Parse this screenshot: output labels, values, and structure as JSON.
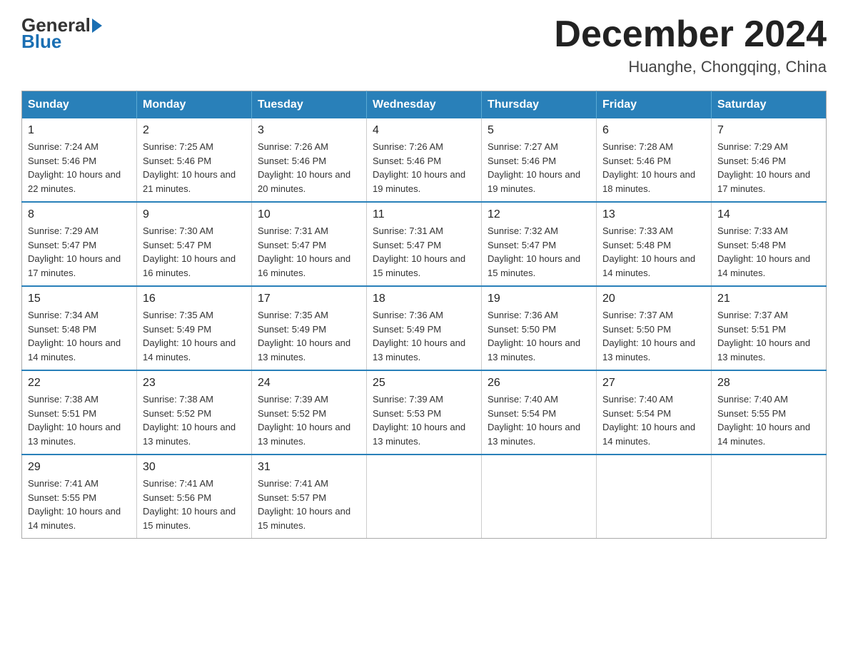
{
  "logo": {
    "general": "General",
    "blue": "Blue"
  },
  "title": "December 2024",
  "location": "Huanghe, Chongqing, China",
  "days_of_week": [
    "Sunday",
    "Monday",
    "Tuesday",
    "Wednesday",
    "Thursday",
    "Friday",
    "Saturday"
  ],
  "weeks": [
    [
      {
        "day": "1",
        "sunrise": "7:24 AM",
        "sunset": "5:46 PM",
        "daylight": "10 hours and 22 minutes."
      },
      {
        "day": "2",
        "sunrise": "7:25 AM",
        "sunset": "5:46 PM",
        "daylight": "10 hours and 21 minutes."
      },
      {
        "day": "3",
        "sunrise": "7:26 AM",
        "sunset": "5:46 PM",
        "daylight": "10 hours and 20 minutes."
      },
      {
        "day": "4",
        "sunrise": "7:26 AM",
        "sunset": "5:46 PM",
        "daylight": "10 hours and 19 minutes."
      },
      {
        "day": "5",
        "sunrise": "7:27 AM",
        "sunset": "5:46 PM",
        "daylight": "10 hours and 19 minutes."
      },
      {
        "day": "6",
        "sunrise": "7:28 AM",
        "sunset": "5:46 PM",
        "daylight": "10 hours and 18 minutes."
      },
      {
        "day": "7",
        "sunrise": "7:29 AM",
        "sunset": "5:46 PM",
        "daylight": "10 hours and 17 minutes."
      }
    ],
    [
      {
        "day": "8",
        "sunrise": "7:29 AM",
        "sunset": "5:47 PM",
        "daylight": "10 hours and 17 minutes."
      },
      {
        "day": "9",
        "sunrise": "7:30 AM",
        "sunset": "5:47 PM",
        "daylight": "10 hours and 16 minutes."
      },
      {
        "day": "10",
        "sunrise": "7:31 AM",
        "sunset": "5:47 PM",
        "daylight": "10 hours and 16 minutes."
      },
      {
        "day": "11",
        "sunrise": "7:31 AM",
        "sunset": "5:47 PM",
        "daylight": "10 hours and 15 minutes."
      },
      {
        "day": "12",
        "sunrise": "7:32 AM",
        "sunset": "5:47 PM",
        "daylight": "10 hours and 15 minutes."
      },
      {
        "day": "13",
        "sunrise": "7:33 AM",
        "sunset": "5:48 PM",
        "daylight": "10 hours and 14 minutes."
      },
      {
        "day": "14",
        "sunrise": "7:33 AM",
        "sunset": "5:48 PM",
        "daylight": "10 hours and 14 minutes."
      }
    ],
    [
      {
        "day": "15",
        "sunrise": "7:34 AM",
        "sunset": "5:48 PM",
        "daylight": "10 hours and 14 minutes."
      },
      {
        "day": "16",
        "sunrise": "7:35 AM",
        "sunset": "5:49 PM",
        "daylight": "10 hours and 14 minutes."
      },
      {
        "day": "17",
        "sunrise": "7:35 AM",
        "sunset": "5:49 PM",
        "daylight": "10 hours and 13 minutes."
      },
      {
        "day": "18",
        "sunrise": "7:36 AM",
        "sunset": "5:49 PM",
        "daylight": "10 hours and 13 minutes."
      },
      {
        "day": "19",
        "sunrise": "7:36 AM",
        "sunset": "5:50 PM",
        "daylight": "10 hours and 13 minutes."
      },
      {
        "day": "20",
        "sunrise": "7:37 AM",
        "sunset": "5:50 PM",
        "daylight": "10 hours and 13 minutes."
      },
      {
        "day": "21",
        "sunrise": "7:37 AM",
        "sunset": "5:51 PM",
        "daylight": "10 hours and 13 minutes."
      }
    ],
    [
      {
        "day": "22",
        "sunrise": "7:38 AM",
        "sunset": "5:51 PM",
        "daylight": "10 hours and 13 minutes."
      },
      {
        "day": "23",
        "sunrise": "7:38 AM",
        "sunset": "5:52 PM",
        "daylight": "10 hours and 13 minutes."
      },
      {
        "day": "24",
        "sunrise": "7:39 AM",
        "sunset": "5:52 PM",
        "daylight": "10 hours and 13 minutes."
      },
      {
        "day": "25",
        "sunrise": "7:39 AM",
        "sunset": "5:53 PM",
        "daylight": "10 hours and 13 minutes."
      },
      {
        "day": "26",
        "sunrise": "7:40 AM",
        "sunset": "5:54 PM",
        "daylight": "10 hours and 13 minutes."
      },
      {
        "day": "27",
        "sunrise": "7:40 AM",
        "sunset": "5:54 PM",
        "daylight": "10 hours and 14 minutes."
      },
      {
        "day": "28",
        "sunrise": "7:40 AM",
        "sunset": "5:55 PM",
        "daylight": "10 hours and 14 minutes."
      }
    ],
    [
      {
        "day": "29",
        "sunrise": "7:41 AM",
        "sunset": "5:55 PM",
        "daylight": "10 hours and 14 minutes."
      },
      {
        "day": "30",
        "sunrise": "7:41 AM",
        "sunset": "5:56 PM",
        "daylight": "10 hours and 15 minutes."
      },
      {
        "day": "31",
        "sunrise": "7:41 AM",
        "sunset": "5:57 PM",
        "daylight": "10 hours and 15 minutes."
      },
      null,
      null,
      null,
      null
    ]
  ]
}
